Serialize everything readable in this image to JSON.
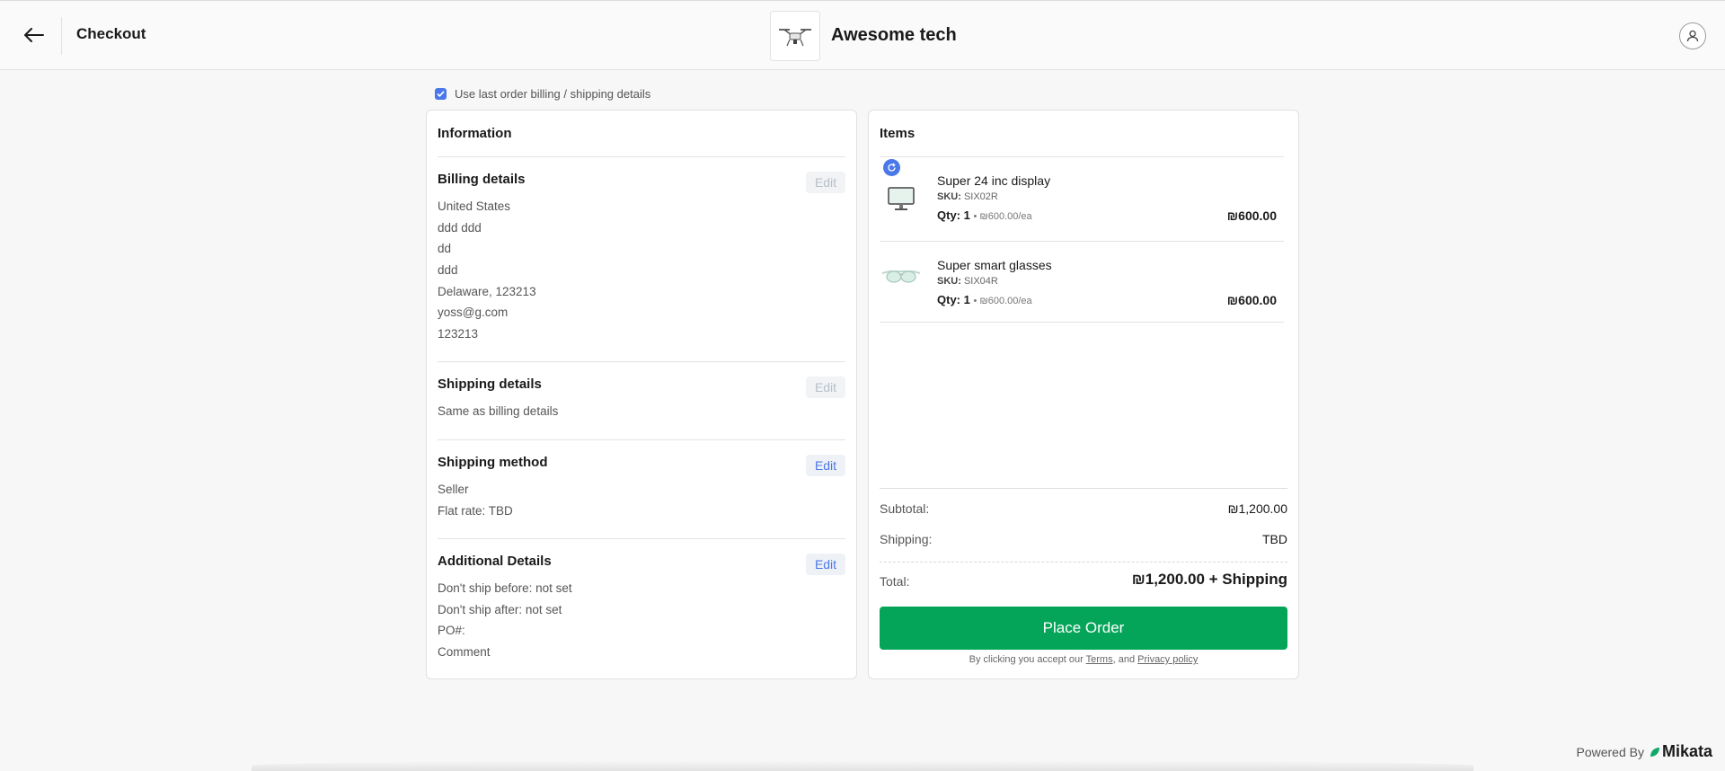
{
  "header": {
    "title": "Checkout",
    "store_name": "Awesome tech"
  },
  "use_last": {
    "label": "Use last order billing / shipping details",
    "checked": true
  },
  "info": {
    "title": "Information",
    "edit_label": "Edit",
    "billing": {
      "title": "Billing details",
      "lines": [
        "United States",
        "ddd ddd",
        "dd",
        "ddd",
        "Delaware, 123213",
        "yoss@g.com",
        "123213"
      ]
    },
    "shipping": {
      "title": "Shipping details",
      "lines": [
        "Same as billing details"
      ]
    },
    "method": {
      "title": "Shipping method",
      "lines": [
        "Seller",
        "Flat rate: TBD"
      ]
    },
    "additional": {
      "title": "Additional Details",
      "lines": [
        "Don't ship before: not set",
        "Don't ship after: not set",
        "PO#:",
        "Comment"
      ]
    }
  },
  "items_card": {
    "title": "Items",
    "items": [
      {
        "name": "Super 24 inc display",
        "sku_label": "SKU:",
        "sku": "SIX02R",
        "qty": "Qty: 1",
        "each": "• ₪600.00/ea",
        "price": "₪600.00",
        "icon": "monitor-icon"
      },
      {
        "name": "Super smart glasses",
        "sku_label": "SKU:",
        "sku": "SIX04R",
        "qty": "Qty: 1",
        "each": "• ₪600.00/ea",
        "price": "₪600.00",
        "icon": "glasses-icon"
      }
    ],
    "subtotal_label": "Subtotal:",
    "subtotal": "₪1,200.00",
    "shipping_label": "Shipping:",
    "shipping": "TBD",
    "total_label": "Total:",
    "total": "₪1,200.00 + Shipping",
    "place_order": "Place Order",
    "accept_prefix": "By clicking you accept our",
    "terms": "Terms",
    "and": ", and",
    "privacy": "Privacy policy"
  },
  "footer": {
    "powered_by": "Powered By",
    "brand": "Mikata"
  },
  "colors": {
    "accent": "#4b78e8",
    "order_button": "#05a559"
  }
}
